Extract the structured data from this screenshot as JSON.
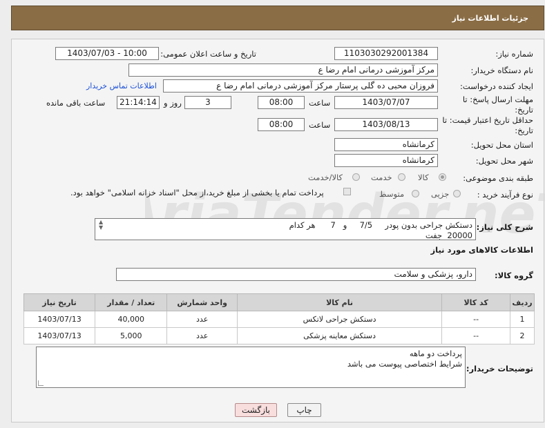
{
  "header": {
    "title": "جزئیات اطلاعات نیاز"
  },
  "form": {
    "need_number_label": "شماره نیاز:",
    "need_number": "1103030292001384",
    "announce_label": "تاریخ و ساعت اعلان عمومی:",
    "announce_value": "1403/07/03 - 10:00",
    "buyer_org_label": "نام دستگاه خریدار:",
    "buyer_org": "مرکز آموزشی  درمانی امام رضا  ع",
    "requester_label": "ایجاد کننده درخواست:",
    "requester": "فروزان محبی ده گلی پرستار مرکز آموزشی  درمانی امام رضا  ع",
    "contact_link": "اطلاعات تماس خریدار",
    "deadline_label_1": "مهلت ارسال پاسخ: تا",
    "deadline_label_2": "تاریخ:",
    "deadline_date": "1403/07/07",
    "time_label": "ساعت",
    "deadline_time": "08:00",
    "days_value": "3",
    "days_label": "روز و",
    "remaining_time": "21:14:14",
    "remaining_label": "ساعت باقی مانده",
    "validity_label_1": "حداقل تاریخ اعتبار قیمت: تا",
    "validity_label_2": "تاریخ:",
    "validity_date": "1403/08/13",
    "validity_time": "08:00",
    "province_label": "استان محل تحویل:",
    "province": "کرمانشاه",
    "city_label": "شهر محل تحویل:",
    "city": "کرمانشاه",
    "category_label": "طبقه بندی موضوعی:",
    "category_options": [
      "کالا",
      "خدمت",
      "کالا/خدمت"
    ],
    "process_label": "نوع فرآیند خرید :",
    "process_options": [
      "جزیی",
      "متوسط"
    ],
    "payment_note": "پرداخت تمام یا بخشی از مبلغ خرید،از محل \"اسناد خزانه اسلامی\" خواهد بود.",
    "description_label": "شرح کلی نیاز:",
    "description_lines": [
      "دستکش جراحی بدون پودر     7/5     و   7      هر کدام",
      "20000  جفت"
    ]
  },
  "goods": {
    "section_title": "اطلاعات کالاهای مورد نیاز",
    "group_label": "گروه کالا:",
    "group_value": "دارو، پزشکی و سلامت",
    "columns": [
      "ردیف",
      "کد کالا",
      "نام کالا",
      "واحد شمارش",
      "تعداد / مقدار",
      "تاریخ نیاز"
    ],
    "rows": [
      {
        "idx": "1",
        "code": "--",
        "name": "دستکش جراحی لاتکس",
        "unit": "عدد",
        "qty": "40,000",
        "date": "1403/07/13"
      },
      {
        "idx": "2",
        "code": "--",
        "name": "دستکش معاینه پزشکی",
        "unit": "عدد",
        "qty": "5,000",
        "date": "1403/07/13"
      }
    ]
  },
  "buyer_notes": {
    "label": "توضیحات خریدار:",
    "lines": [
      "پرداخت دو ماهه",
      "شرایط اختصاصی پیوست می باشد"
    ]
  },
  "buttons": {
    "print": "چاپ",
    "back": "بازگشت"
  },
  "watermark": {
    "text": "AriaTender.neT"
  }
}
